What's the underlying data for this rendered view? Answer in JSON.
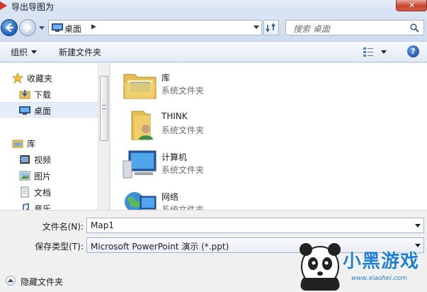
{
  "window": {
    "title": "导出导图为"
  },
  "address_bar": {
    "path": "桌面",
    "search_placeholder": "搜索 桌面"
  },
  "toolbar": {
    "organize_label": "组织",
    "new_folder_label": "新建文件夹"
  },
  "nav_pane": {
    "items": [
      {
        "label": "收藏夹",
        "icon": "star-icon"
      },
      {
        "label": "下载",
        "icon": "download-folder-icon"
      },
      {
        "label": "桌面",
        "icon": "desktop-icon",
        "selected": true
      },
      {
        "label": "库",
        "icon": "library-icon"
      },
      {
        "label": "视频",
        "icon": "video-icon"
      },
      {
        "label": "图片",
        "icon": "picture-icon"
      },
      {
        "label": "文档",
        "icon": "document-icon"
      },
      {
        "label": "音乐",
        "icon": "music-icon"
      }
    ]
  },
  "content": {
    "items": [
      {
        "name": "库",
        "desc": "系统文件夹",
        "icon": "library-folder-icon"
      },
      {
        "name": "THINK",
        "desc": "系统文件夹",
        "icon": "user-folder-icon"
      },
      {
        "name": "计算机",
        "desc": "系统文件夹",
        "icon": "computer-icon"
      },
      {
        "name": "网络",
        "desc": "系统文件夹",
        "icon": "network-icon"
      }
    ]
  },
  "form": {
    "filename_label": "文件名(N):",
    "filename_value": "Map1",
    "filetype_label": "保存类型(T):",
    "filetype_value": "Microsoft PowerPoint 演示 (*.ppt)"
  },
  "footer": {
    "hide_folders_label": "隐藏文件夹"
  },
  "watermark": {
    "brand": "小黑游戏",
    "url": "www.xiaohei.com"
  },
  "colors": {
    "accent": "#1d5fb8",
    "selection": "#e5edf8",
    "close": "#c7452f"
  }
}
